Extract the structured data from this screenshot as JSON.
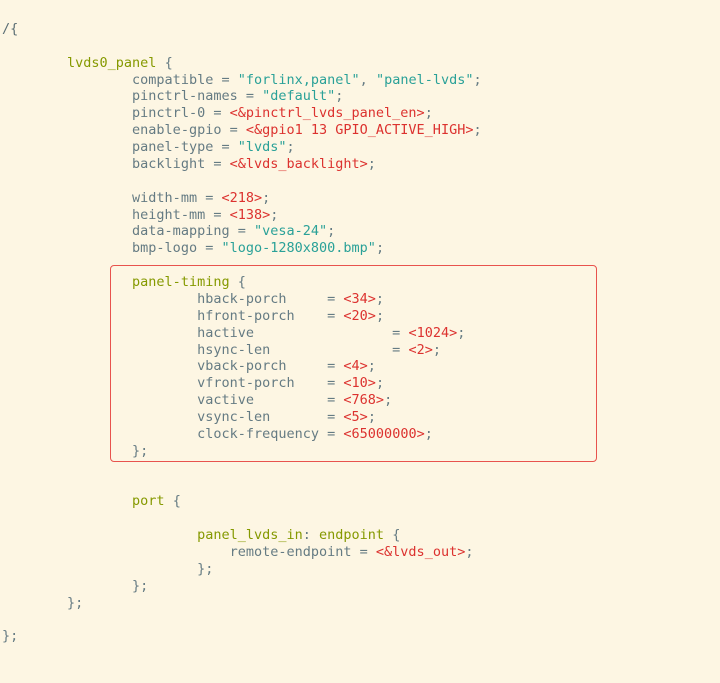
{
  "root_open": "/{",
  "lvds0": {
    "name": "lvds0_panel",
    "props": {
      "compatible_k": "compatible",
      "compatible_v1": "\"forlinx,panel\"",
      "compatible_v2": "\"panel-lvds\"",
      "pinctrl_names_k": "pinctrl-names",
      "pinctrl_names_v": "\"default\"",
      "pinctrl0_k": "pinctrl-0",
      "pinctrl0_v": "<&pinctrl_lvds_panel_en>",
      "enable_gpio_k": "enable-gpio",
      "enable_gpio_v": "<&gpio1 13 GPIO_ACTIVE_HIGH>",
      "panel_type_k": "panel-type",
      "panel_type_v": "\"lvds\"",
      "backlight_k": "backlight",
      "backlight_v": "<&lvds_backlight>",
      "width_mm_k": "width-mm",
      "width_mm_v": "<218>",
      "height_mm_k": "height-mm",
      "height_mm_v": "<138>",
      "data_mapping_k": "data-mapping",
      "data_mapping_v": "\"vesa-24\"",
      "bmp_logo_k": "bmp-logo",
      "bmp_logo_v": "\"logo-1280x800.bmp\""
    },
    "panel_timing": {
      "name": "panel-timing",
      "hback_porch_k": "hback-porch",
      "hback_porch_v": "<34>",
      "hfront_porch_k": "hfront-porch",
      "hfront_porch_v": "<20>",
      "hactive_k": "hactive",
      "hactive_v": "<1024>",
      "hsync_len_k": "hsync-len",
      "hsync_len_v": "<2>",
      "vback_porch_k": "vback-porch",
      "vback_porch_v": "<4>",
      "vfront_porch_k": "vfront-porch",
      "vfront_porch_v": "<10>",
      "vactive_k": "vactive",
      "vactive_v": "<768>",
      "vsync_len_k": "vsync-len",
      "vsync_len_v": "<5>",
      "clock_freq_k": "clock-frequency",
      "clock_freq_v": "<65000000>"
    },
    "port": {
      "name": "port",
      "panel_lvds_in": "panel_lvds_in",
      "endpoint": "endpoint",
      "remote_endpoint_k": "remote-endpoint",
      "remote_endpoint_v": "<&lvds_out>"
    }
  },
  "close_brace": "};"
}
